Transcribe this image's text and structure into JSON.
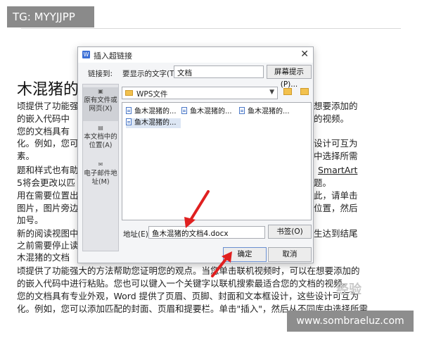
{
  "watermarks": {
    "tg": "TG: MYYJJPP",
    "site": "www.sombraeluz.com",
    "exp": "经验"
  },
  "document": {
    "title": "木混猪的",
    "lines": [
      "顷提供了功能强",
      "的嵌入代码中",
      "您的文档具有",
      "化。例如，您可",
      "素。",
      "题和样式也有助",
      "5将会更改以匹",
      "用在需要位置出",
      "图片，图片旁边",
      "加号。",
      "新的阅读视图中",
      "之前需要停止读",
      "木混猪的文档",
      "顷提供了功能强大的方法帮助您证明您的观点。当您单击联机视频时，可以在想要添加的",
      "的嵌入代码中进行粘贴。您也可以键入一个关键字以联机搜索最适合您的文档的视频。",
      "您的文档具有专业外观，Word 提供了页眉、页脚、封面和文本框设计，这些设计可互为",
      "化。例如，您可以添加匹配的封面、页眉和提要栏。单击\"插入\"，然后从不同库中选择所需"
    ],
    "right_lines": [
      "想要添加的",
      "的视频。",
      "设计可互为",
      "中选择所需",
      "",
      "SmartArt",
      "题。",
      "此，请单击",
      "位置，然后",
      "",
      "生达到结尾"
    ]
  },
  "dialog": {
    "title": "插入超链接",
    "link_to_label": "链接到:",
    "display_text_label": "要显示的文字(T):",
    "display_text_value": "文档",
    "screen_tip_label": "屏幕提示(P)...",
    "sidebar": [
      {
        "label": "原有文件或网页(X)",
        "icon": "globe-page-icon",
        "active": true
      },
      {
        "label": "本文档中的位置(A)",
        "icon": "document-place-icon",
        "active": false
      },
      {
        "label": "电子邮件地址(M)",
        "icon": "envelope-icon",
        "active": false
      }
    ],
    "folder": "WPS文件",
    "files": [
      "鱼木混猪的...",
      "鱼木混猪的...",
      "鱼木混猪的...",
      "鱼木混猪的..."
    ],
    "address_label": "地址(E):",
    "address_value": "鱼木混猪的文档4.docx",
    "bookmark_label": "书签(O)",
    "ok_label": "确定",
    "cancel_label": "取消"
  },
  "colors": {
    "annotation_arrow": "#e02020",
    "selection": "#dce6f4",
    "folder": "#f2c14e"
  }
}
